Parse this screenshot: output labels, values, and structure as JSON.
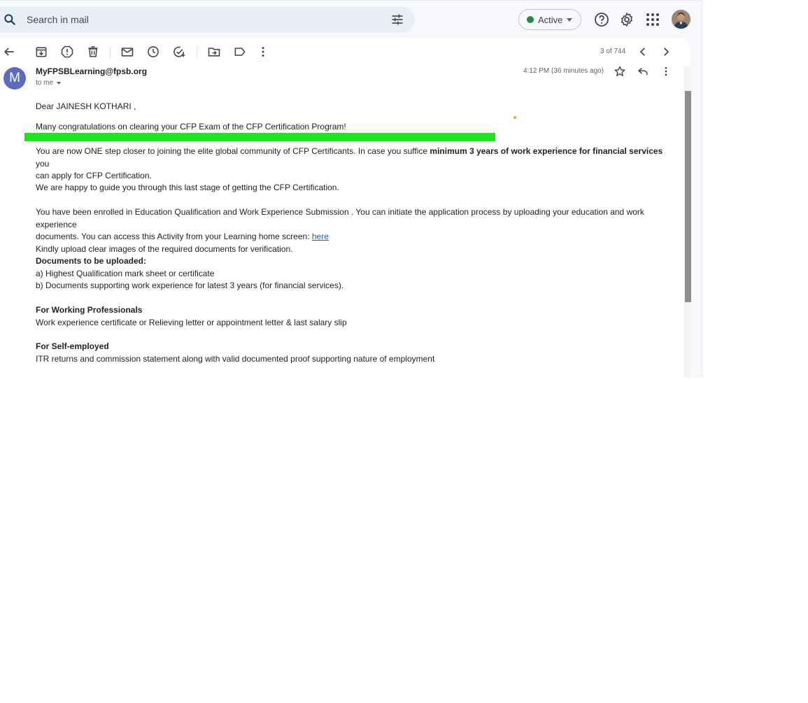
{
  "search": {
    "placeholder": "Search in mail"
  },
  "status": {
    "label": "Active",
    "color": "#1e8e3e"
  },
  "header_icons": [
    "search-icon",
    "filter-icon",
    "help-icon",
    "settings-icon",
    "apps-icon",
    "avatar"
  ],
  "toolbar": {
    "icons": [
      "back-icon",
      "archive-icon",
      "report-spam-icon",
      "delete-icon",
      "mark-unread-icon",
      "snooze-icon",
      "add-task-icon",
      "move-to-icon",
      "label-icon",
      "more-icon"
    ],
    "pager": "3 of 744"
  },
  "message": {
    "avatar_letter": "M",
    "sender": "MyFPSBLearning@fpsb.org",
    "to": "to me",
    "time": "4:12 PM (36 minutes ago)",
    "greeting": "Dear  JAINESH KOTHARI ,",
    "congrats": "Many congratulations on clearing your CFP Exam of the CFP Certification Program!",
    "p1_a": "You are now ONE step closer to joining the elite global community of CFP Certificants. In case you suffice ",
    "p1_bold": "minimum 3 years of work experience for financial services",
    "p1_b": " you",
    "p1_c": "can apply for CFP Certification.",
    "p2": "We are happy to guide you through this last stage of getting the CFP Certification.",
    "p3_a": "You have been enrolled in  Education Qualification and Work Experience Submission . You can initiate the application process by uploading your education and work experience",
    "p3_b": "documents. You can access this Activity from your Learning home screen:  ",
    "p3_link": "here",
    "p4": "Kindly upload clear images of the required documents for verification.",
    "docs_heading": "Documents to be uploaded:",
    "doc_a": "a) Highest Qualification mark sheet or certificate",
    "doc_b": "b) Documents supporting work experience for latest 3 years (for financial services).",
    "wp_heading": "For Working Professionals",
    "wp_text": "Work experience certificate or Relieving letter or appointment letter & last salary slip",
    "se_heading": "For Self-employed",
    "se_text": "ITR returns and commission statement along with valid documented proof supporting nature of employment"
  }
}
